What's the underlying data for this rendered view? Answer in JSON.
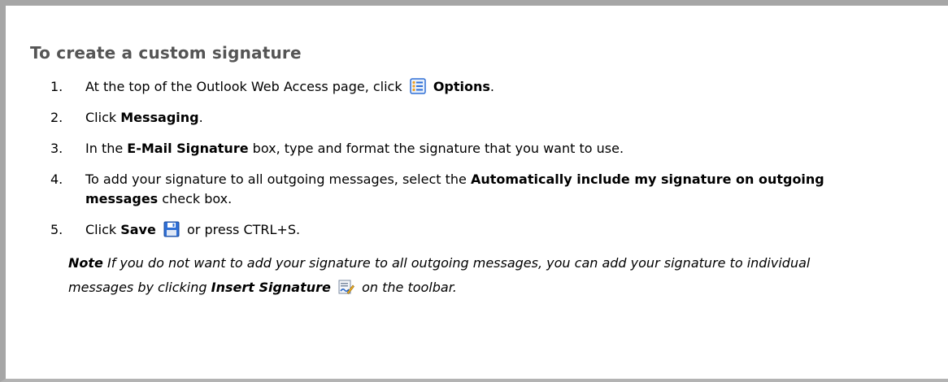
{
  "title": "To create a custom signature",
  "steps": [
    {
      "number": "1.",
      "text_before": "At the top of the Outlook Web Access page, click",
      "bold": "Options",
      "text_after": ".",
      "icon": "options-icon"
    },
    {
      "number": "2.",
      "text_before": "Click",
      "bold": "Messaging",
      "text_after": "."
    },
    {
      "number": "3.",
      "text_before": "In the",
      "bold": "E-Mail Signature",
      "text_after": "box, type and format the signature that you want to use."
    },
    {
      "number": "4.",
      "text_before": "To add your signature to all outgoing messages, select the",
      "bold": "Automatically include my signature on outgoing messages",
      "text_after": "check box."
    },
    {
      "number": "5.",
      "text_before": "Click",
      "bold": "Save",
      "text_after": "or press CTRL+S.",
      "icon": "save-icon"
    }
  ],
  "note": {
    "label": "Note",
    "text_before": "If you do not want to add your signature to all outgoing messages, you can add your signature to individual messages by clicking",
    "bold": "Insert Signature",
    "text_after": "on the toolbar.",
    "icon": "insert-signature-icon"
  },
  "colors": {
    "title": "#555555",
    "frame_border": "#a6a6a6",
    "icon_blue": "#2f6fd6"
  }
}
